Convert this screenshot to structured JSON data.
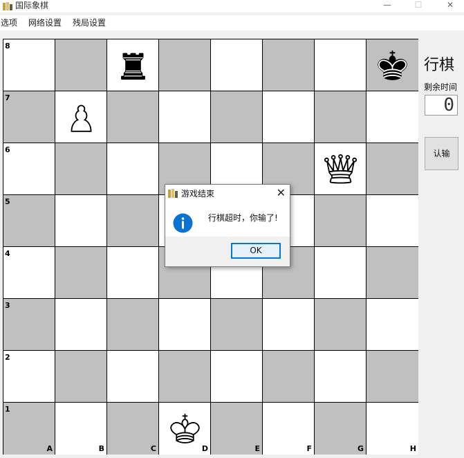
{
  "window": {
    "title": "国际象棋"
  },
  "menu": [
    "选项",
    "网络设置",
    "残局设置"
  ],
  "board": {
    "ranks": [
      "8",
      "7",
      "6",
      "5",
      "4",
      "3",
      "2",
      "1"
    ],
    "files": [
      "A",
      "B",
      "C",
      "D",
      "E",
      "F",
      "G",
      "H"
    ],
    "light_color": "#ffffff",
    "dark_color": "#c0c0c0",
    "pieces": [
      {
        "square": "c8",
        "name": "black-rook-icon"
      },
      {
        "square": "h8",
        "name": "black-king-icon"
      },
      {
        "square": "b7",
        "name": "white-pawn-icon"
      },
      {
        "square": "g6",
        "name": "white-queen-icon"
      },
      {
        "square": "d1",
        "name": "white-king-icon"
      }
    ]
  },
  "side": {
    "turn_label": "行棋",
    "time_label": "剩余时间",
    "timer_value": "0",
    "resign_label": "认输"
  },
  "dialog": {
    "title": "游戏结束",
    "message": "行棋超时，你输了!",
    "ok_label": "OK",
    "close_glyph": "✕"
  },
  "icons": {
    "minimize": "—",
    "maximize": "☐",
    "close": "✕"
  }
}
